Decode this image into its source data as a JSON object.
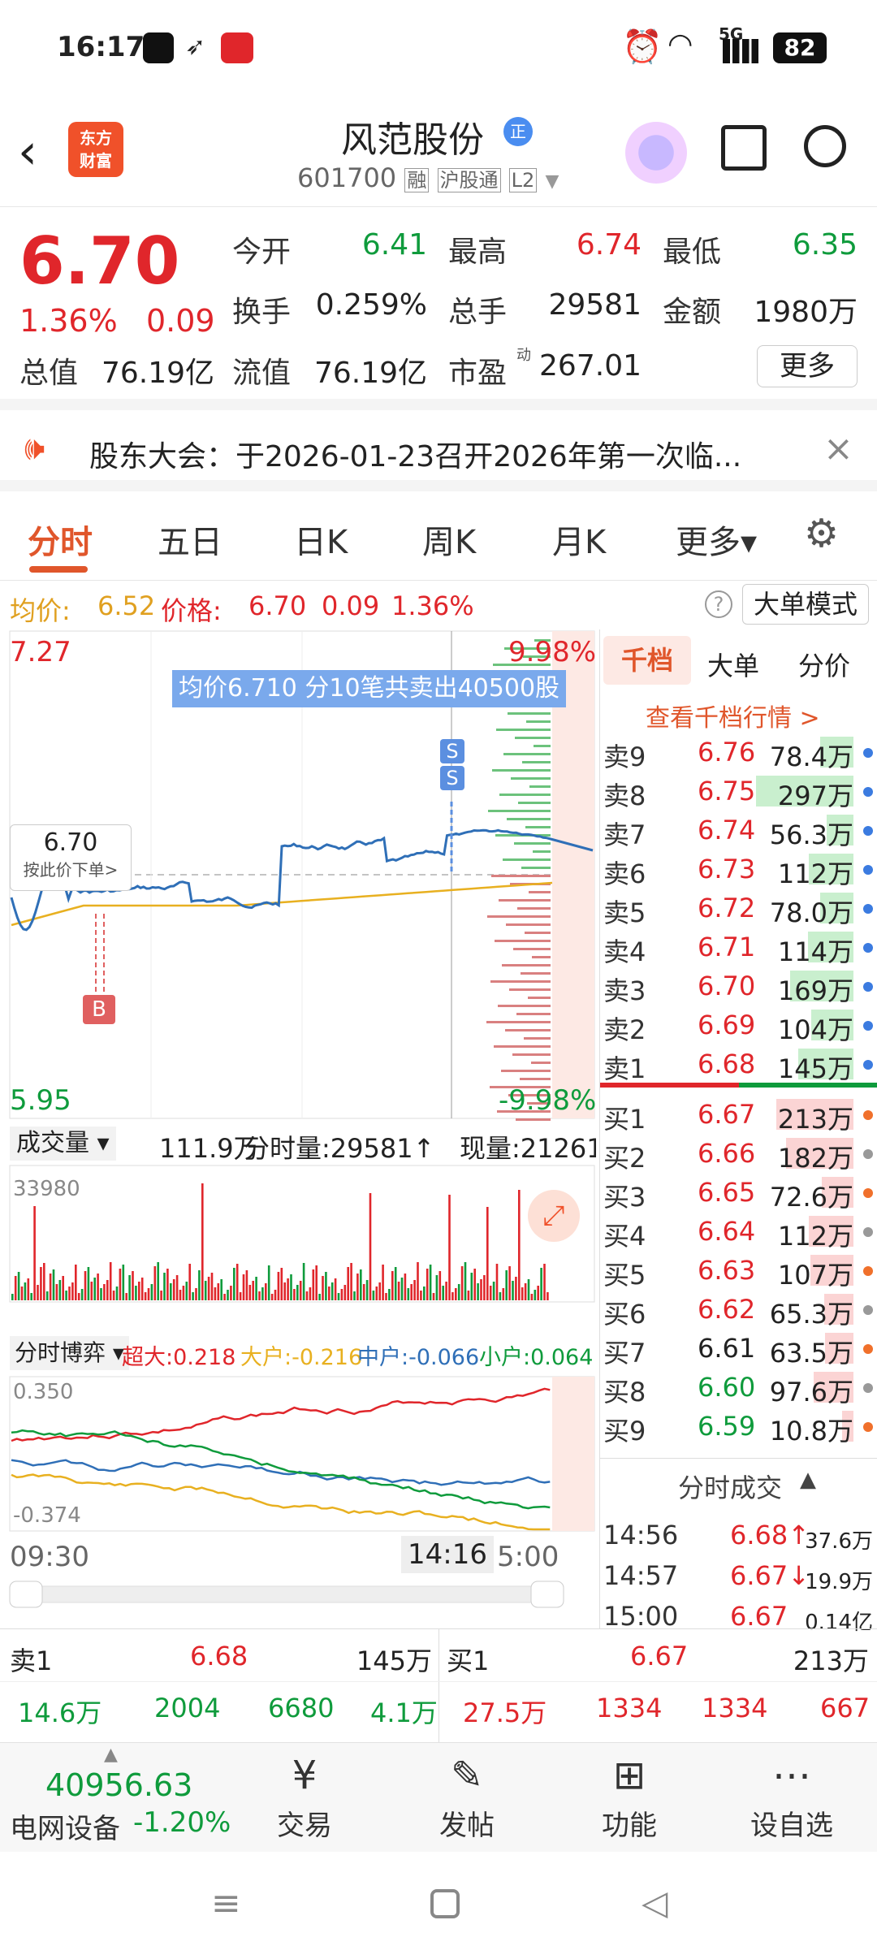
{
  "status": {
    "time": "16:17",
    "net": "5G",
    "battery": "82"
  },
  "header": {
    "logo_line1": "东方",
    "logo_line2": "财富",
    "title": "风范股份",
    "title_badge": "正",
    "code": "601700",
    "tag1": "融",
    "tag2": "沪股通",
    "tag3": "L2"
  },
  "quote": {
    "price": "6.70",
    "change_pct": "1.36%",
    "change": "0.09",
    "open_label": "今开",
    "open": "6.41",
    "high_label": "最高",
    "high": "6.74",
    "low_label": "最低",
    "low": "6.35",
    "turnover_label": "换手",
    "turnover": "0.259%",
    "volume_label": "总手",
    "volume": "29581",
    "amount_label": "金额",
    "amount": "1980万",
    "mcap_label": "总值",
    "mcap": "76.19亿",
    "float_label": "流值",
    "float": "76.19亿",
    "pe_label": "市盈",
    "pe_sup": "动",
    "pe": "267.01",
    "more_label": "更多"
  },
  "notice": {
    "text": "股东大会：于2026-01-23召开2026年第一次临..."
  },
  "tabs": [
    "分时",
    "五日",
    "日K",
    "周K",
    "月K",
    "更多▾"
  ],
  "info": {
    "avg_label": "均价:",
    "avg": "6.52",
    "price_label": "价格:",
    "price": "6.70",
    "change": "0.09",
    "pct": "1.36%",
    "big_mode": "大单模式"
  },
  "chart": {
    "y_top": "7.27",
    "pct_top": "9.98%",
    "y_bottom": "5.95",
    "pct_bottom": "-9.98%",
    "tooltip": "均价6.710  分10笔共卖出40500股",
    "price_marker": "6.70",
    "price_marker_sub": "按此价下单>",
    "b_marker": "B",
    "s_marker": "S",
    "vol_label": "成交量 ▾",
    "vol_total": "111.9万",
    "fs_vol": "分时量:29581↑",
    "cur_vol": "现量:21261",
    "vol_max": "33980",
    "fund_label": "分时博弈 ▾",
    "super": "超大:0.218",
    "big": "大户:-0.216",
    "mid": "中户:-0.066",
    "small": "小户:0.064",
    "fund_top": "0.350",
    "fund_bottom": "-0.374",
    "time_start": "09:30",
    "time_cursor": "14:16",
    "time_end": "5:00"
  },
  "orderbook": {
    "tabs": [
      "千档",
      "大单",
      "分价"
    ],
    "link": "查看千档行情 >",
    "sells": [
      {
        "label": "卖9",
        "price": "6.76",
        "vol": "78.4万"
      },
      {
        "label": "卖8",
        "price": "6.75",
        "vol": "297万"
      },
      {
        "label": "卖7",
        "price": "6.74",
        "vol": "56.3万"
      },
      {
        "label": "卖6",
        "price": "6.73",
        "vol": "112万"
      },
      {
        "label": "卖5",
        "price": "6.72",
        "vol": "78.0万"
      },
      {
        "label": "卖4",
        "price": "6.71",
        "vol": "114万"
      },
      {
        "label": "卖3",
        "price": "6.70",
        "vol": "169万"
      },
      {
        "label": "卖2",
        "price": "6.69",
        "vol": "104万"
      },
      {
        "label": "卖1",
        "price": "6.68",
        "vol": "145万"
      }
    ],
    "buys": [
      {
        "label": "买1",
        "price": "6.67",
        "vol": "213万"
      },
      {
        "label": "买2",
        "price": "6.66",
        "vol": "182万"
      },
      {
        "label": "买3",
        "price": "6.65",
        "vol": "72.6万"
      },
      {
        "label": "买4",
        "price": "6.64",
        "vol": "112万"
      },
      {
        "label": "买5",
        "price": "6.63",
        "vol": "107万"
      },
      {
        "label": "买6",
        "price": "6.62",
        "vol": "65.3万"
      },
      {
        "label": "买7",
        "price": "6.61",
        "vol": "63.5万"
      },
      {
        "label": "买8",
        "price": "6.60",
        "vol": "97.6万"
      },
      {
        "label": "买9",
        "price": "6.59",
        "vol": "10.8万"
      }
    ],
    "trades_title": "分时成交",
    "trades": [
      {
        "time": "14:56",
        "price": "6.68↑",
        "vol": "37.6万"
      },
      {
        "time": "14:57",
        "price": "6.67↓",
        "vol": "19.9万"
      },
      {
        "time": "15:00",
        "price": "6.67",
        "vol": "0.14亿"
      }
    ]
  },
  "bottom": {
    "sell_label": "卖1",
    "sell_price": "6.68",
    "sell_vol": "145万",
    "buy_label": "买1",
    "buy_price": "6.67",
    "buy_vol": "213万",
    "row2": [
      "14.6万",
      "2004",
      "6680",
      "4.1万",
      "27.5万",
      "1334",
      "1334",
      "667"
    ]
  },
  "nav": {
    "index_value": "40956.63",
    "index_name": "电网设备",
    "index_pct": "-1.20%",
    "items": [
      "交易",
      "发帖",
      "功能",
      "设自选"
    ]
  }
}
